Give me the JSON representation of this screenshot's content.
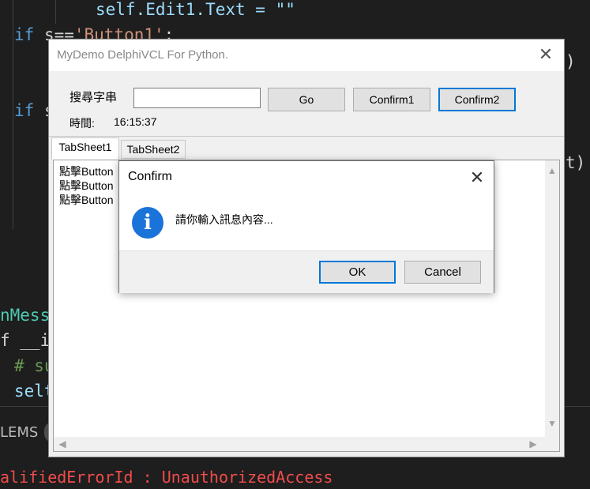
{
  "editor": {
    "line1": "self.Edit1.Text = \"\"",
    "line2_kw": "if",
    "line2_rest": " s==",
    "line2_str": "'Button1'",
    "line2_tail": ":",
    "line3_kw": "if",
    "line3_rest": " s",
    "paren1": ")",
    "paren2": "t)",
    "line4": "nMessa",
    "line5": "f __in",
    "line6": "# su",
    "line7": "selt",
    "problems_label": "LEMS",
    "error_text": "alifiedErrorId : UnauthorizedAccess"
  },
  "window": {
    "title": "MyDemo DelphiVCL For Python.",
    "close_glyph": "✕",
    "search_label": "搜尋字串",
    "search_value": "",
    "go_label": "Go",
    "confirm1_label": "Confirm1",
    "confirm2_label": "Confirm2",
    "time_label": "時間:",
    "time_value": "16:15:37",
    "tabs": [
      "TabSheet1",
      "TabSheet2"
    ],
    "memo_lines": [
      "點擊Button",
      "點擊Button",
      "點擊Button"
    ],
    "scroll_up": "▲",
    "scroll_down": "▼",
    "scroll_left": "◀",
    "scroll_right": "▶"
  },
  "dialog": {
    "title": "Confirm",
    "close_glyph": "✕",
    "icon_glyph": "i",
    "message": "請你輸入訊息內容...",
    "ok_label": "OK",
    "cancel_label": "Cancel"
  },
  "colors": {
    "accent": "#0078d7",
    "info_icon": "#1a73d9",
    "error": "#f14c4c"
  }
}
